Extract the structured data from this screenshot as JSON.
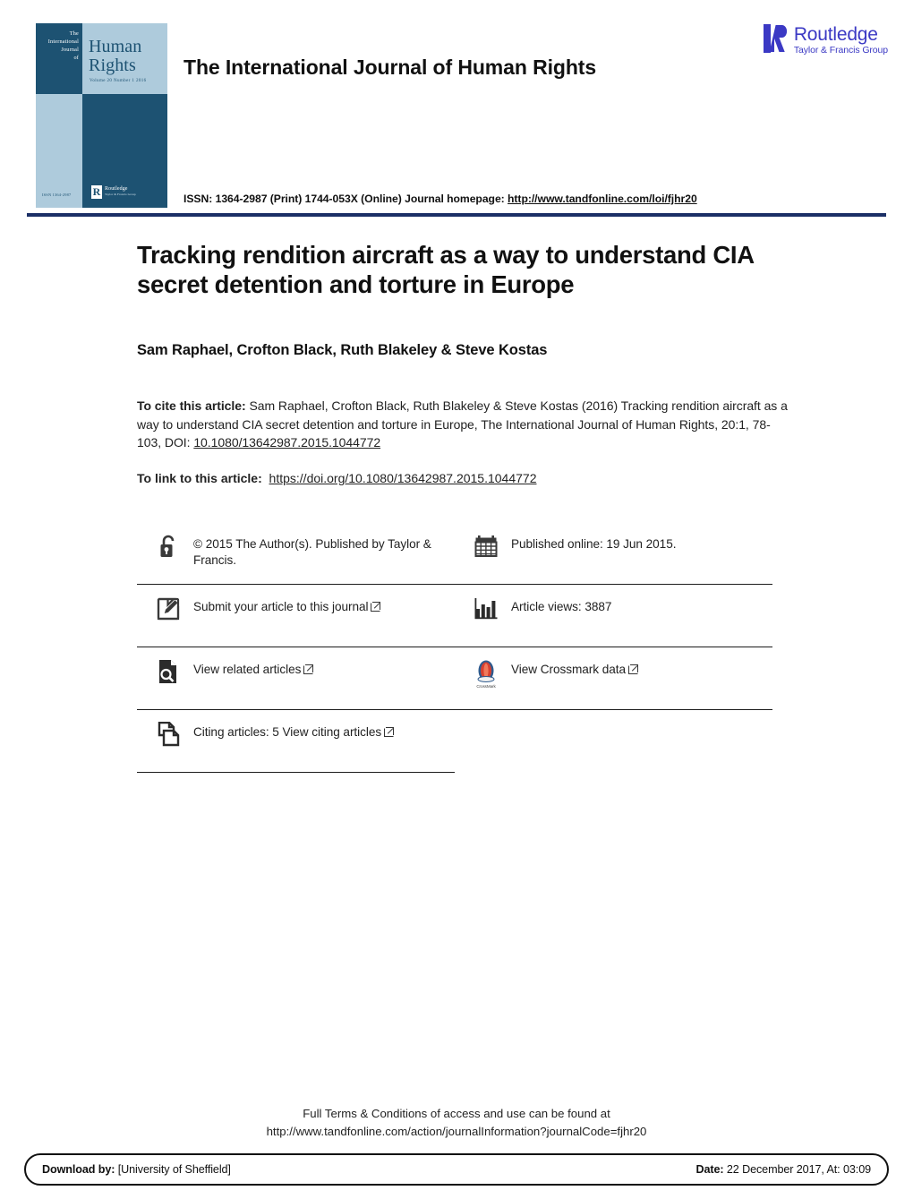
{
  "header": {
    "journal_title": "The International Journal of Human Rights",
    "issn_prefix": "ISSN: 1364-2987 (Print) 1744-053X (Online) Journal homepage: ",
    "issn_link": "http://www.tandfonline.com/loi/fjhr20",
    "publisher": {
      "name": "Routledge",
      "tagline": "Taylor & Francis Group",
      "mark_letter": "R",
      "color": "#3b39c4"
    },
    "cover": {
      "kicker_line1": "The",
      "kicker_line2": "International",
      "kicker_line3": "Journal",
      "kicker_line4": "of",
      "title_line1": "Human",
      "title_line2": "Rights",
      "volume": "Volume 20   Number 1   2016",
      "issn": "ISSN 1364-2987",
      "imprint": "Routledge",
      "imprint_sub": "Taylor & Francis Group",
      "imprint_mark": "R",
      "color_dark": "#1d5272",
      "color_light": "#aecbdc"
    },
    "rule_color": "#1b2f66"
  },
  "article": {
    "title": "Tracking rendition aircraft as a way to understand CIA secret detention and torture in Europe",
    "authors": "Sam Raphael, Crofton Black, Ruth Blakeley & Steve Kostas",
    "cite_label": "To cite this article:",
    "cite_body": " Sam Raphael, Crofton Black, Ruth Blakeley & Steve Kostas (2016) Tracking rendition aircraft as a way to understand CIA secret detention and torture in Europe, The International Journal of Human Rights, 20:1, 78-103, DOI: ",
    "cite_doi": "10.1080/13642987.2015.1044772",
    "link_label": "To link to this article:",
    "link_url": "https://doi.org/10.1080/13642987.2015.1044772"
  },
  "meta": {
    "copyright": "© 2015 The Author(s). Published by Taylor & Francis.",
    "published_online": "Published online: 19 Jun 2015.",
    "submit": "Submit your article to this journal",
    "article_views": "Article views: 3887",
    "related": "View related articles",
    "crossmark": "View Crossmark data",
    "crossmark_label": "CrossMark",
    "citing": "Citing articles: 5 View citing articles"
  },
  "footer": {
    "terms_line1": "Full Terms & Conditions of access and use can be found at",
    "terms_line2": "http://www.tandfonline.com/action/journalInformation?journalCode=fjhr20",
    "download_label": "Download by:",
    "download_value": " [University of Sheffield]",
    "date_label": "Date:",
    "date_value": " 22 December 2017, At: 03:09"
  }
}
